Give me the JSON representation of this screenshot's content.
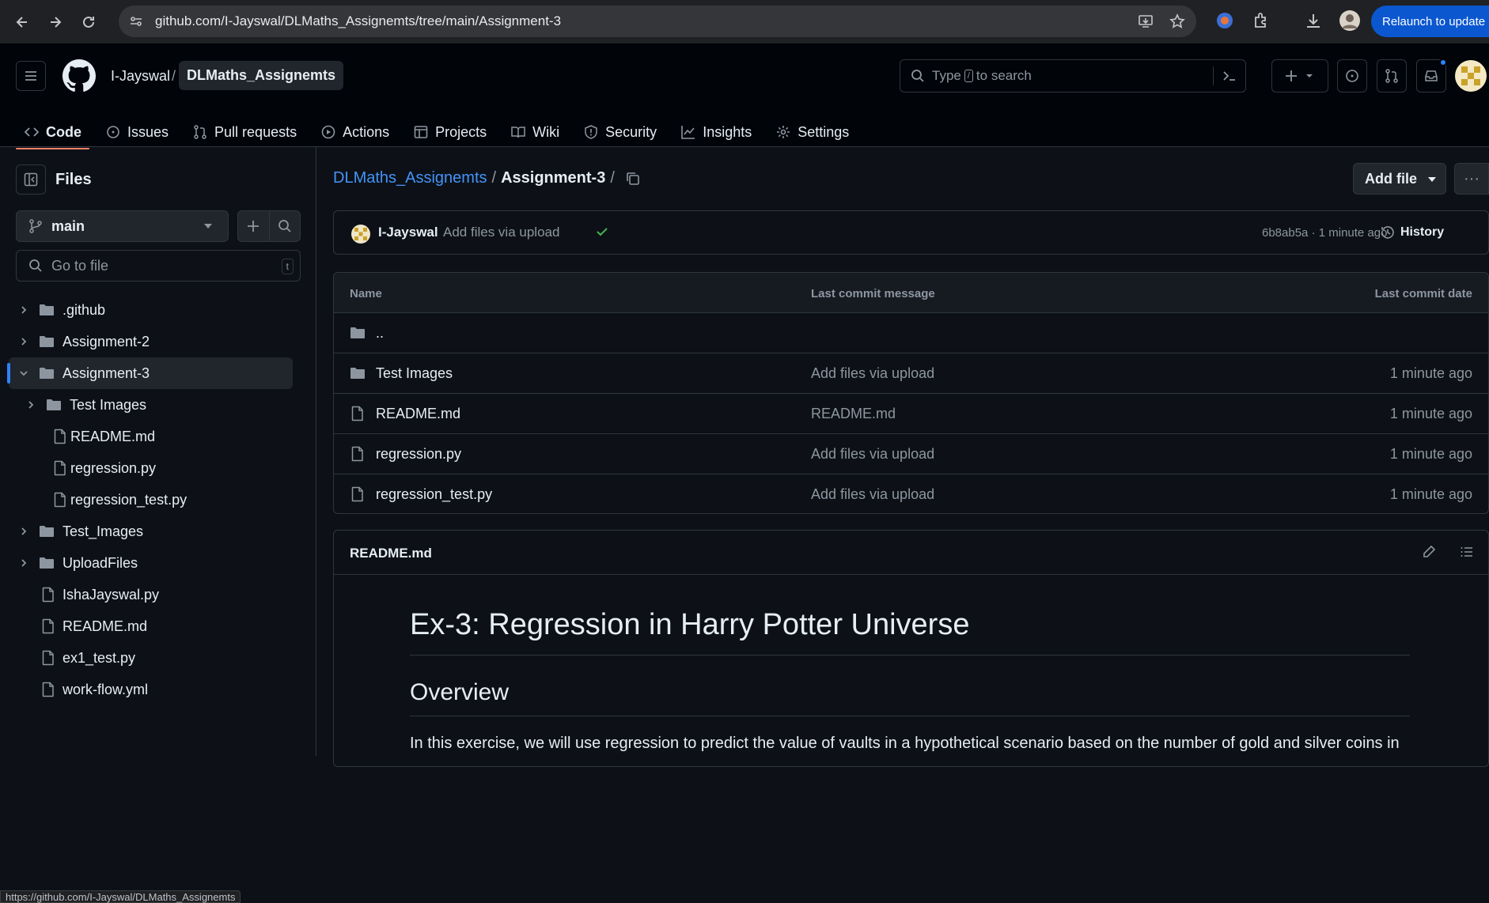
{
  "browser": {
    "url": "github.com/I-Jayswal/DLMaths_Assignemts/tree/main/Assignment-3",
    "relaunch_label": "Relaunch to update",
    "status_url": "https://github.com/I-Jayswal/DLMaths_Assignemts"
  },
  "header": {
    "owner": "I-Jayswal",
    "separator": "/",
    "repo": "DLMaths_Assignemts",
    "search_prefix": "Type",
    "search_key": "/",
    "search_suffix": "to search"
  },
  "repo_tabs": [
    {
      "label": "Code",
      "icon": "code-icon",
      "active": true
    },
    {
      "label": "Issues",
      "icon": "issue-icon"
    },
    {
      "label": "Pull requests",
      "icon": "pull-request-icon"
    },
    {
      "label": "Actions",
      "icon": "play-icon"
    },
    {
      "label": "Projects",
      "icon": "table-icon"
    },
    {
      "label": "Wiki",
      "icon": "book-icon"
    },
    {
      "label": "Security",
      "icon": "shield-icon"
    },
    {
      "label": "Insights",
      "icon": "graph-icon"
    },
    {
      "label": "Settings",
      "icon": "gear-icon"
    }
  ],
  "sidebar": {
    "title": "Files",
    "branch": "main",
    "goto_placeholder": "Go to file",
    "goto_key": "t",
    "tree": [
      {
        "label": ".github",
        "type": "folder",
        "depth": 0,
        "expanded": false
      },
      {
        "label": "Assignment-2",
        "type": "folder",
        "depth": 0,
        "expanded": false
      },
      {
        "label": "Assignment-3",
        "type": "folder",
        "depth": 0,
        "expanded": true,
        "selected": true
      },
      {
        "label": "Test Images",
        "type": "folder",
        "depth": 1,
        "expanded": false
      },
      {
        "label": "README.md",
        "type": "file",
        "depth": 1
      },
      {
        "label": "regression.py",
        "type": "file",
        "depth": 1
      },
      {
        "label": "regression_test.py",
        "type": "file",
        "depth": 1
      },
      {
        "label": "Test_Images",
        "type": "folder",
        "depth": 0,
        "expanded": false
      },
      {
        "label": "UploadFiles",
        "type": "folder",
        "depth": 0,
        "expanded": false
      },
      {
        "label": "IshaJayswal.py",
        "type": "file",
        "depth": 0
      },
      {
        "label": "README.md",
        "type": "file",
        "depth": 0
      },
      {
        "label": "ex1_test.py",
        "type": "file",
        "depth": 0
      },
      {
        "label": "work-flow.yml",
        "type": "file",
        "depth": 0
      }
    ]
  },
  "main": {
    "path_repo": "DLMaths_Assignemts",
    "path_sep": "/",
    "path_current": "Assignment-3",
    "path_trailing": "/",
    "add_file_label": "Add file",
    "more_label": "···",
    "commit": {
      "author": "I-Jayswal",
      "message": "Add files via upload",
      "sha_time": "6b8ab5a · 1 minute ago",
      "history_label": "History"
    },
    "table": {
      "headers": [
        "Name",
        "Last commit message",
        "Last commit date"
      ],
      "rows": [
        {
          "name": "..",
          "type": "folder",
          "message": "",
          "date": ""
        },
        {
          "name": "Test Images",
          "type": "folder",
          "message": "Add files via upload",
          "date": "1 minute ago"
        },
        {
          "name": "README.md",
          "type": "file",
          "message": "README.md",
          "date": "1 minute ago"
        },
        {
          "name": "regression.py",
          "type": "file",
          "message": "Add files via upload",
          "date": "1 minute ago"
        },
        {
          "name": "regression_test.py",
          "type": "file",
          "message": "Add files via upload",
          "date": "1 minute ago"
        }
      ]
    },
    "readme": {
      "filename": "README.md",
      "h1": "Ex-3: Regression in Harry Potter Universe",
      "h2": "Overview",
      "para": "In this exercise, we will use regression to predict the value of vaults in a hypothetical scenario based on the number of gold and silver coins in"
    }
  },
  "colors": {
    "accent": "#f78166",
    "link": "#4493f8",
    "success": "#3fb950",
    "relaunch": "#0b57d0"
  }
}
